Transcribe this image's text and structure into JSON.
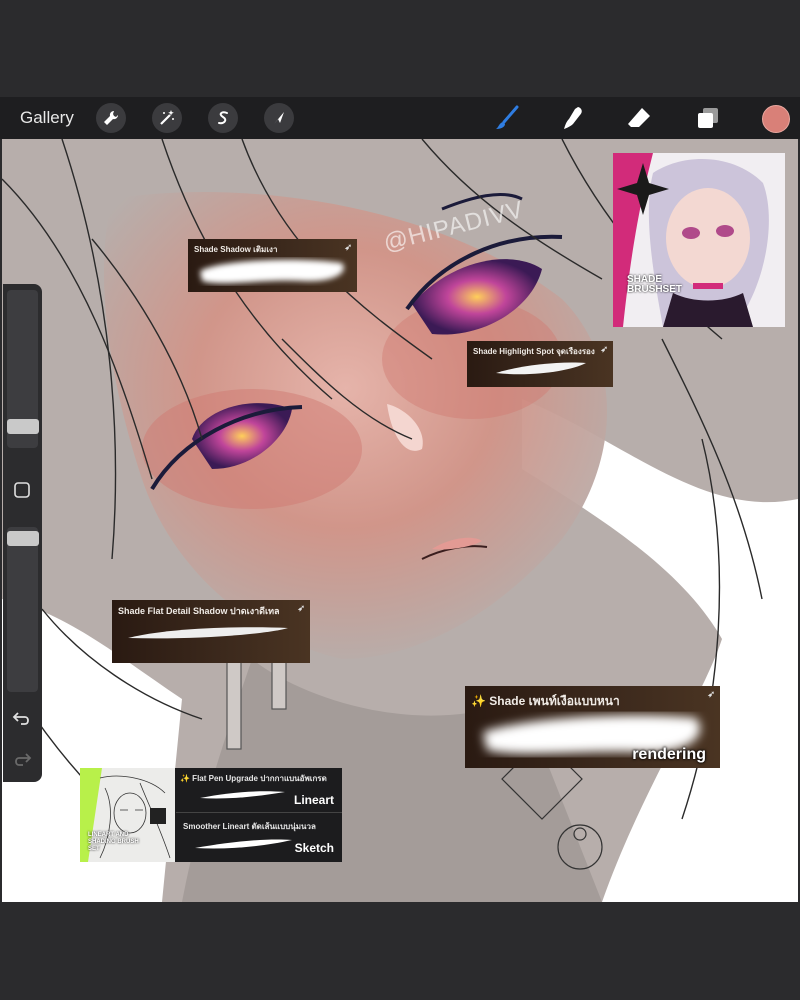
{
  "toolbar": {
    "gallery_label": "Gallery",
    "left_tools": [
      {
        "name": "actions",
        "icon": "wrench-icon"
      },
      {
        "name": "adjustments",
        "icon": "magic-wand-icon"
      },
      {
        "name": "selection",
        "icon": "selection-s-icon"
      },
      {
        "name": "transform",
        "icon": "arrow-cursor-icon"
      }
    ],
    "right_tools": [
      {
        "name": "brush",
        "icon": "brush-icon",
        "active": true
      },
      {
        "name": "smudge",
        "icon": "smudge-finger-icon"
      },
      {
        "name": "eraser",
        "icon": "eraser-icon"
      },
      {
        "name": "layers",
        "icon": "layers-icon"
      }
    ],
    "current_color": "#d98078"
  },
  "canvas": {
    "watermark": "@HIPADIVV",
    "background": "#b7aeab"
  },
  "sidebar": {
    "size_slider_level": 0.76,
    "opacity_slider_level": 0.98,
    "modify_button_icon": "square-icon",
    "undo_icon": "undo-arrow-icon",
    "redo_icon": "redo-arrow-icon"
  },
  "brush_cards": {
    "shade_shadow": {
      "title": "Shade Shadow เติมเงา"
    },
    "shade_highlight_spot": {
      "title": "Shade Highlight Spot จุดเรืองรอง"
    },
    "shade_flat_detail": {
      "title": "Shade Flat Detail Shadow ปาดเงาดีเทล"
    },
    "shade_paint": {
      "title": "✨ Shade เพนท์เงือแบบหนา",
      "label": "rendering"
    }
  },
  "promo": {
    "title_line1": "SHADE",
    "title_line2": "BRUSHSET"
  },
  "lineart_set": {
    "thumb_text": "LINEART AND SHADING BRUSH SET",
    "flat_pen_title": "✨ Flat Pen Upgrade ปากกาแบนอัพเกรด",
    "flat_pen_label": "Lineart",
    "smoother_title": "Smoother Lineart ตัดเส้นแบบนุ่มนวล",
    "smoother_label": "Sketch"
  }
}
